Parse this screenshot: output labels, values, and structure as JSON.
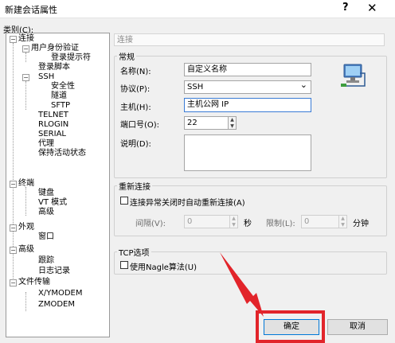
{
  "window": {
    "title": "新建会话属性",
    "help": "?",
    "close": "✕"
  },
  "category_label": "类别(C):",
  "tree": [
    {
      "label": "连接",
      "bold": true,
      "expander": "−"
    },
    {
      "label": "用户身份验证",
      "bold": true,
      "expander": "−"
    },
    {
      "label": "登录提示符",
      "bold": false
    },
    {
      "label": "登录脚本",
      "bold": false
    },
    {
      "label": "SSH",
      "bold": false,
      "expander": "−"
    },
    {
      "label": "安全性",
      "bold": false
    },
    {
      "label": "隧道",
      "bold": true
    },
    {
      "label": "SFTP",
      "bold": false
    },
    {
      "label": "TELNET",
      "bold": false
    },
    {
      "label": "RLOGIN",
      "bold": false
    },
    {
      "label": "SERIAL",
      "bold": false
    },
    {
      "label": "代理",
      "bold": false
    },
    {
      "label": "保持活动状态",
      "bold": false
    },
    {
      "label": "终端",
      "bold": true,
      "expander": "−"
    },
    {
      "label": "键盘",
      "bold": true
    },
    {
      "label": "VT 模式",
      "bold": false
    },
    {
      "label": "高级",
      "bold": false
    },
    {
      "label": "外观",
      "bold": true,
      "expander": "−"
    },
    {
      "label": "窗口",
      "bold": false
    },
    {
      "label": "高级",
      "bold": false,
      "expander": "−"
    },
    {
      "label": "跟踪",
      "bold": false
    },
    {
      "label": "日志记录",
      "bold": true
    },
    {
      "label": "文件传输",
      "bold": true,
      "expander": "−"
    },
    {
      "label": "X/YMODEM",
      "bold": false
    },
    {
      "label": "ZMODEM",
      "bold": false
    }
  ],
  "panel_title": "连接",
  "general": {
    "title": "常规",
    "name_label": "名称(N):",
    "name_value": "自定义名称",
    "protocol_label": "协议(P):",
    "protocol_value": "SSH",
    "protocol_arrow": "⌄",
    "host_label": "主机(H):",
    "host_value": "主机公网 IP",
    "port_label": "端口号(O):",
    "port_value": "22",
    "desc_label": "说明(D):",
    "desc_value": ""
  },
  "reconnect": {
    "title": "重新连接",
    "auto_label": "连接异常关闭时自动重新连接(A)",
    "interval_label": "间隔(V):",
    "interval_value": "0",
    "interval_unit": "秒",
    "limit_label": "限制(L):",
    "limit_value": "0",
    "limit_unit": "分钟"
  },
  "tcp": {
    "title": "TCP选项",
    "nagle_label": "使用Nagle算法(U)"
  },
  "buttons": {
    "ok": "确定",
    "cancel": "取消"
  },
  "spin": {
    "up": "▲",
    "down": "▼"
  },
  "icons": {
    "computer": "computer-network-icon"
  },
  "colors": {
    "highlight_border": "#e2242a",
    "arrow": "#e2242a",
    "focus": "#3a7bd5"
  }
}
